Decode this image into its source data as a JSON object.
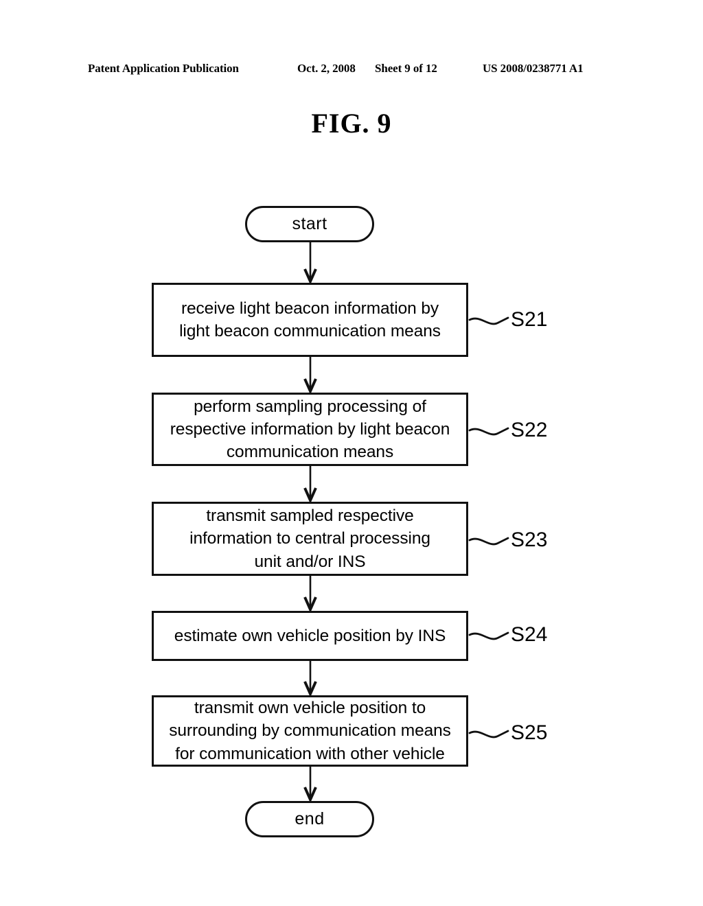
{
  "header": {
    "publication": "Patent Application Publication",
    "date": "Oct. 2, 2008",
    "sheet": "Sheet 9 of 12",
    "patent_number": "US 2008/0238771 A1"
  },
  "figure": {
    "title": "FIG. 9"
  },
  "flowchart": {
    "type": "flowchart",
    "orientation": "vertical",
    "nodes": [
      {
        "id": "start",
        "shape": "terminator",
        "text": "start"
      },
      {
        "id": "s21",
        "shape": "process",
        "text": "receive light beacon information by\nlight beacon communication means",
        "ref": "S21"
      },
      {
        "id": "s22",
        "shape": "process",
        "text": "perform sampling processing of\nrespective information by light beacon\ncommunication means",
        "ref": "S22"
      },
      {
        "id": "s23",
        "shape": "process",
        "text": "transmit sampled respective\ninformation to central processing\nunit and/or INS",
        "ref": "S23"
      },
      {
        "id": "s24",
        "shape": "process",
        "text": "estimate own vehicle position by INS",
        "ref": "S24"
      },
      {
        "id": "s25",
        "shape": "process",
        "text": "transmit own vehicle position to\nsurrounding by communication means\nfor communication with other vehicle",
        "ref": "S25"
      },
      {
        "id": "end",
        "shape": "terminator",
        "text": "end"
      }
    ],
    "labels": {
      "s21": "S21",
      "s22": "S22",
      "s23": "S23",
      "s24": "S24",
      "s25": "S25"
    },
    "edges": [
      {
        "from": "start",
        "to": "s21",
        "arrow": "down"
      },
      {
        "from": "s21",
        "to": "s22",
        "arrow": "down"
      },
      {
        "from": "s22",
        "to": "s23",
        "arrow": "down"
      },
      {
        "from": "s23",
        "to": "s24",
        "arrow": "down"
      },
      {
        "from": "s24",
        "to": "s25",
        "arrow": "down"
      },
      {
        "from": "s25",
        "to": "end",
        "arrow": "down"
      }
    ],
    "colors": {
      "ink": "#111111",
      "paper": "#ffffff"
    }
  }
}
